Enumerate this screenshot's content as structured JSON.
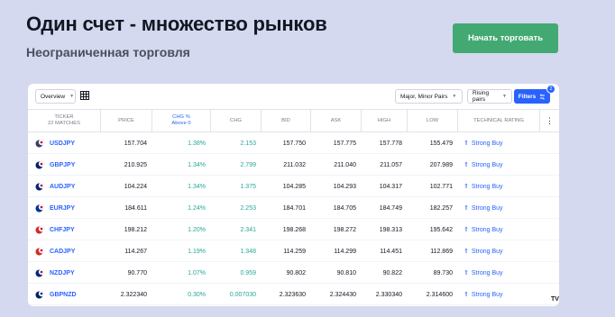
{
  "hero": {
    "title": "Один счет - множество рынков",
    "subtitle": "Неограниченная торговля",
    "cta_label": "Начать торговать",
    "cta_color": "#43a972"
  },
  "toolbar": {
    "view_select": "Overview",
    "grid_icon": "grid-view-icon",
    "pairs_select": "Major, Minor Pairs",
    "sort_select": "Rising pairs",
    "filters_label": "Filters",
    "filters_badge": "2",
    "accent_color": "#2962ff"
  },
  "table": {
    "headers": {
      "ticker": "TICKER",
      "ticker_sub": "22 MATCHES",
      "price": "PRICE",
      "chg_pct": "CHG %",
      "chg_pct_sub": "Above 0",
      "chg": "CHG",
      "bid": "BID",
      "ask": "ASK",
      "high": "HIGH",
      "low": "LOW",
      "rating": "TECHNICAL RATING",
      "menu": "⋮"
    },
    "rows": [
      {
        "symbol": "USDJPY",
        "price": "157.704",
        "chg_pct": "1.38%",
        "chg": "2.153",
        "bid": "157.750",
        "ask": "157.775",
        "high": "157.778",
        "low": "155.479",
        "rating": "Strong Buy",
        "flag_a": "#3c3b6e",
        "flag_b": "#bc002d"
      },
      {
        "symbol": "GBPJPY",
        "price": "210.925",
        "chg_pct": "1.34%",
        "chg": "2.799",
        "bid": "211.032",
        "ask": "211.040",
        "high": "211.057",
        "low": "207.989",
        "rating": "Strong Buy",
        "flag_a": "#012169",
        "flag_b": "#bc002d"
      },
      {
        "symbol": "AUDJPY",
        "price": "104.224",
        "chg_pct": "1.34%",
        "chg": "1.375",
        "bid": "104.285",
        "ask": "104.293",
        "high": "104.317",
        "low": "102.771",
        "rating": "Strong Buy",
        "flag_a": "#00247d",
        "flag_b": "#bc002d"
      },
      {
        "symbol": "EURJPY",
        "price": "184.611",
        "chg_pct": "1.24%",
        "chg": "2.253",
        "bid": "184.701",
        "ask": "184.705",
        "high": "184.749",
        "low": "182.257",
        "rating": "Strong Buy",
        "flag_a": "#003399",
        "flag_b": "#bc002d"
      },
      {
        "symbol": "CHFJPY",
        "price": "198.212",
        "chg_pct": "1.20%",
        "chg": "2.341",
        "bid": "198.268",
        "ask": "198.272",
        "high": "198.313",
        "low": "195.642",
        "rating": "Strong Buy",
        "flag_a": "#d52b1e",
        "flag_b": "#bc002d"
      },
      {
        "symbol": "CADJPY",
        "price": "114.267",
        "chg_pct": "1.19%",
        "chg": "1.348",
        "bid": "114.259",
        "ask": "114.299",
        "high": "114.451",
        "low": "112.869",
        "rating": "Strong Buy",
        "flag_a": "#d52b1e",
        "flag_b": "#bc002d"
      },
      {
        "symbol": "NZDJPY",
        "price": "90.770",
        "chg_pct": "1.07%",
        "chg": "0.959",
        "bid": "90.802",
        "ask": "90.810",
        "high": "90.822",
        "low": "89.730",
        "rating": "Strong Buy",
        "flag_a": "#00247d",
        "flag_b": "#bc002d"
      },
      {
        "symbol": "GBPNZD",
        "price": "2.322340",
        "chg_pct": "0.30%",
        "chg": "0.007030",
        "bid": "2.323630",
        "ask": "2.324430",
        "high": "2.330340",
        "low": "2.314600",
        "rating": "Strong Buy",
        "flag_a": "#012169",
        "flag_b": "#00247d"
      }
    ]
  },
  "brand": {
    "logo_text": "TV"
  }
}
